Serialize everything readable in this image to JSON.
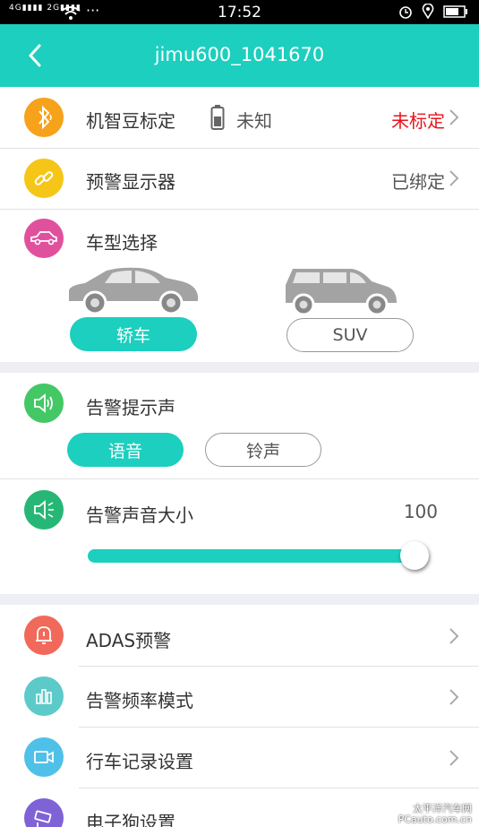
{
  "status_bar": {
    "network": "4G 2G",
    "time": "17:52"
  },
  "header": {
    "title": "jimu600_1041670"
  },
  "calibration": {
    "label": "机智豆标定",
    "battery_text": "未知",
    "status": "未标定",
    "status_color": "#e8141c"
  },
  "display": {
    "label": "预警显示器",
    "status": "已绑定"
  },
  "car_type": {
    "label": "车型选择",
    "options": [
      "轿车",
      "SUV"
    ],
    "selected": "轿车"
  },
  "alert_sound": {
    "label": "告警提示声",
    "options": [
      "语音",
      "铃声"
    ],
    "selected": "语音"
  },
  "volume": {
    "label": "告警声音大小",
    "value": "100",
    "level_percent": 100
  },
  "menu": [
    {
      "label": "ADAS预警",
      "icon": "bell-icon",
      "color": "#f0695a"
    },
    {
      "label": "告警频率模式",
      "icon": "bar-chart-icon",
      "color": "#5ccac8"
    },
    {
      "label": "行车记录设置",
      "icon": "video-camera-icon",
      "color": "#4fc1e8"
    },
    {
      "label": "电子狗设置",
      "icon": "speed-camera-icon",
      "color": "#7f62d6"
    }
  ],
  "watermark": {
    "line1": "太平洋汽车网",
    "line2": "PCauto.com.cn"
  },
  "colors": {
    "accent": "#1ccfbe",
    "bluetooth": "#f7a21b",
    "link": "#f5c518",
    "car": "#e0519d",
    "sound": "#44c765",
    "volume": "#26b776"
  }
}
